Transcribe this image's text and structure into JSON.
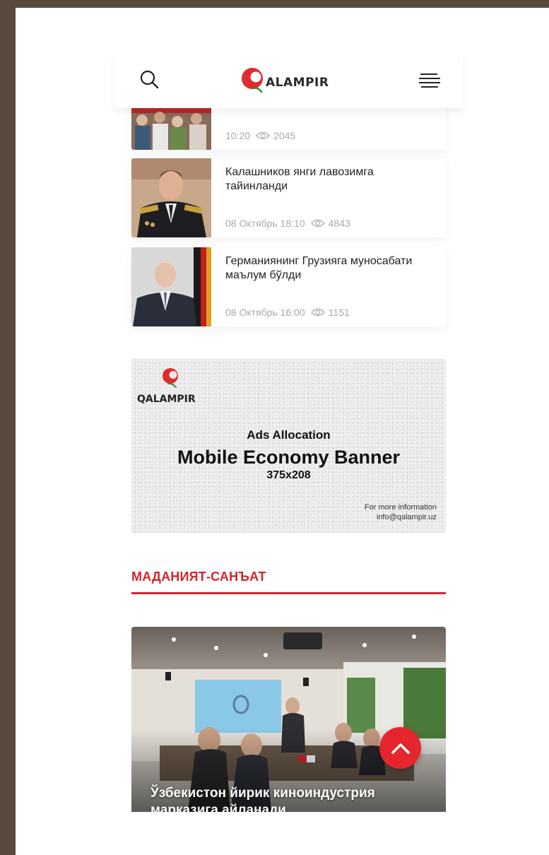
{
  "header": {
    "logo_text": "ALAMPIR",
    "search_icon": "search-icon",
    "menu_icon": "hamburger-menu-icon",
    "accent_color": "#d2262f"
  },
  "news": [
    {
      "title": "",
      "time": "10:20",
      "views": "2045"
    },
    {
      "title": "Калашников янги лавозимга тайинланди",
      "time": "08 Октябрь 18:10",
      "views": "4843"
    },
    {
      "title": "Германиянинг Грузияга муносабати маълум бўлди",
      "time": "08 Октябрь 16:00",
      "views": "1151"
    }
  ],
  "ad": {
    "logo_text": "QALAMPIR",
    "subtitle": "Ads Allocation",
    "title": "Mobile Economy Banner",
    "size": "375x208",
    "info_line1": "For more information",
    "info_line2": "info@qalampir.uz"
  },
  "section": {
    "title": "МАДАНИЯТ-САНЪАТ"
  },
  "feature": {
    "title": "Ўзбекистон йирик киноиндустрия марказига айланади"
  },
  "scroll_top": {
    "icon": "chevron-up-icon",
    "color": "#e5262d"
  }
}
